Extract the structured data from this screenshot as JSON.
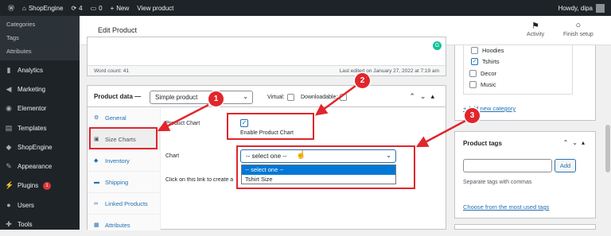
{
  "adminbar": {
    "site": "ShopEngine",
    "updates": "4",
    "comments": "0",
    "new": "New",
    "view": "View product",
    "howdy": "Howdy, dipa"
  },
  "sidebar": {
    "submenu": [
      "Categories",
      "Tags",
      "Attributes"
    ],
    "items": [
      {
        "label": "Analytics",
        "icon": "bar-chart-icon",
        "glyph": "▮"
      },
      {
        "label": "Marketing",
        "icon": "megaphone-icon",
        "glyph": "◀"
      },
      {
        "label": "Elementor",
        "icon": "elementor-icon",
        "glyph": "◉"
      },
      {
        "label": "Templates",
        "icon": "folder-icon",
        "glyph": "▤"
      },
      {
        "label": "ShopEngine",
        "icon": "shopengine-icon",
        "glyph": "◆"
      },
      {
        "label": "Appearance",
        "icon": "brush-icon",
        "glyph": "✎"
      },
      {
        "label": "Plugins",
        "icon": "plugin-icon",
        "glyph": "⚡",
        "badge": "1"
      },
      {
        "label": "Users",
        "icon": "users-icon",
        "glyph": "●"
      },
      {
        "label": "Tools",
        "icon": "wrench-icon",
        "glyph": "✚"
      }
    ]
  },
  "header": {
    "title": "Edit Product",
    "activity": "Activity",
    "finish": "Finish setup"
  },
  "editor": {
    "word_count": "Word count: 41",
    "last_edited": "Last edited on January 27, 2022 at 7:19 am"
  },
  "product_data": {
    "label": "Product data —",
    "type": "Simple product",
    "virtual": "Virtual:",
    "downloadable": "Downloadable:",
    "tabs": [
      {
        "label": "General",
        "icon": "wrench-icon",
        "glyph": "⚙"
      },
      {
        "label": "Size Charts",
        "icon": "size-chart-icon",
        "glyph": "▣"
      },
      {
        "label": "Inventory",
        "icon": "inventory-icon",
        "glyph": "◆"
      },
      {
        "label": "Shipping",
        "icon": "truck-icon",
        "glyph": "▬"
      },
      {
        "label": "Linked Products",
        "icon": "link-icon",
        "glyph": "∞"
      },
      {
        "label": "Attributes",
        "icon": "list-icon",
        "glyph": "▦"
      }
    ],
    "product_chart_label": "Product Chart",
    "enable_label": "Enable Product Chart",
    "chart_label": "Chart",
    "select_value": "-- select one --",
    "options": [
      "-- select one --",
      "Tshirt Size"
    ],
    "create_hint": "Click on this link to create a"
  },
  "categories": {
    "items": [
      {
        "label": "Hoodies",
        "checked": false
      },
      {
        "label": "Tshirts",
        "checked": true
      },
      {
        "label": "Decor",
        "checked": false
      },
      {
        "label": "Music",
        "checked": false
      }
    ],
    "add_link": "+ Add new category"
  },
  "tags": {
    "title": "Product tags",
    "add_button": "Add",
    "hint": "Separate tags with commas",
    "choose_link": "Choose from the most used tags"
  },
  "annotations": {
    "step1": "1",
    "step2": "2",
    "step3": "3",
    "color": "#e0262c"
  }
}
